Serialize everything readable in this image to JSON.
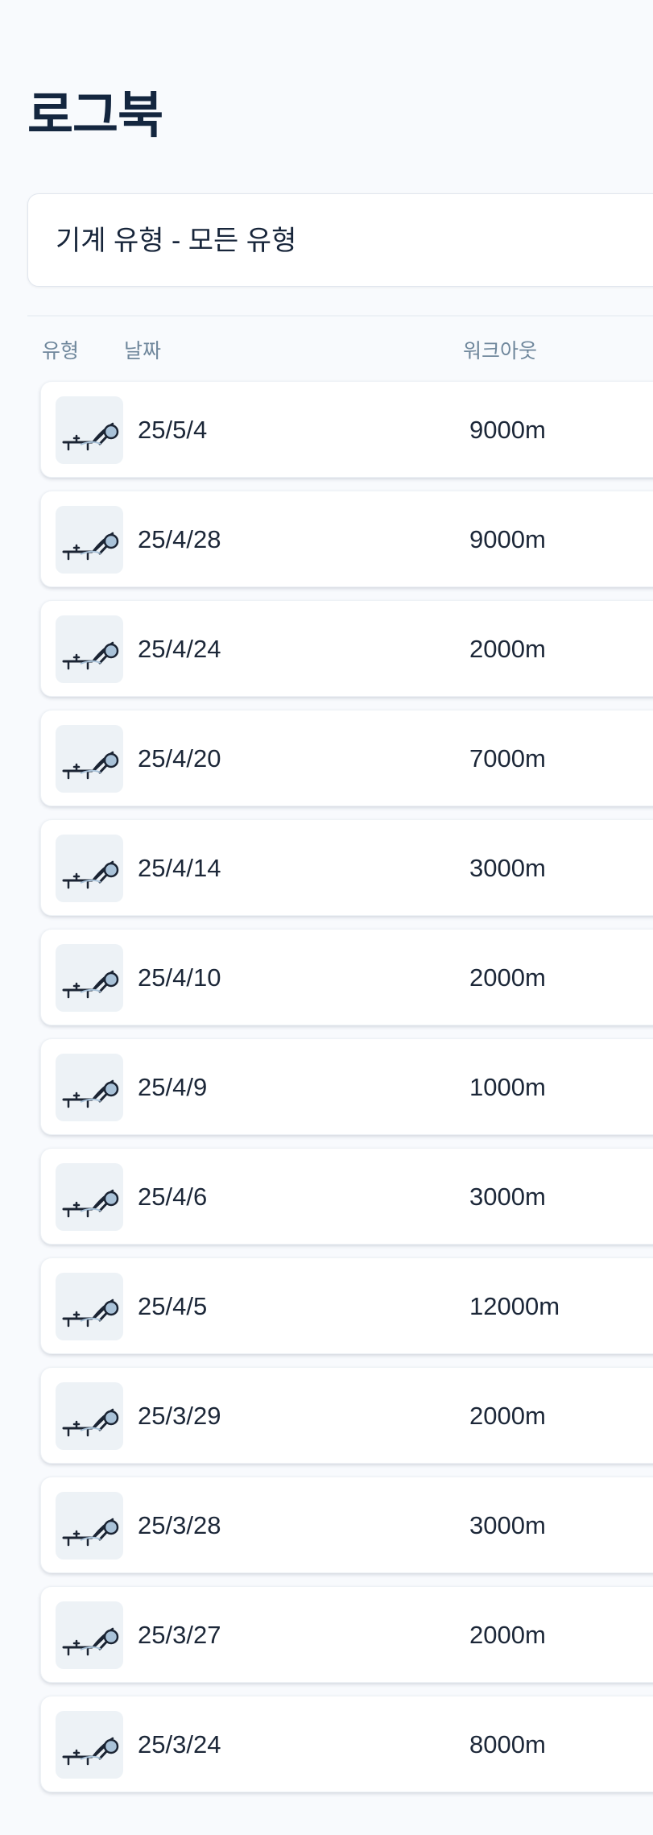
{
  "page": {
    "title": "로그북",
    "filter": {
      "label": "기계 유형 - 모든 유형"
    },
    "columns": {
      "type": "유형",
      "date": "날짜",
      "workout": "워크아웃"
    }
  },
  "icons": {
    "row_type": "rower-icon"
  },
  "logs": [
    {
      "date": "25/5/4",
      "workout": "9000m"
    },
    {
      "date": "25/4/28",
      "workout": "9000m"
    },
    {
      "date": "25/4/24",
      "workout": "2000m"
    },
    {
      "date": "25/4/20",
      "workout": "7000m"
    },
    {
      "date": "25/4/14",
      "workout": "3000m"
    },
    {
      "date": "25/4/10",
      "workout": "2000m"
    },
    {
      "date": "25/4/9",
      "workout": "1000m"
    },
    {
      "date": "25/4/6",
      "workout": "3000m"
    },
    {
      "date": "25/4/5",
      "workout": "12000m"
    },
    {
      "date": "25/3/29",
      "workout": "2000m"
    },
    {
      "date": "25/3/28",
      "workout": "3000m"
    },
    {
      "date": "25/3/27",
      "workout": "2000m"
    },
    {
      "date": "25/3/24",
      "workout": "8000m"
    }
  ]
}
